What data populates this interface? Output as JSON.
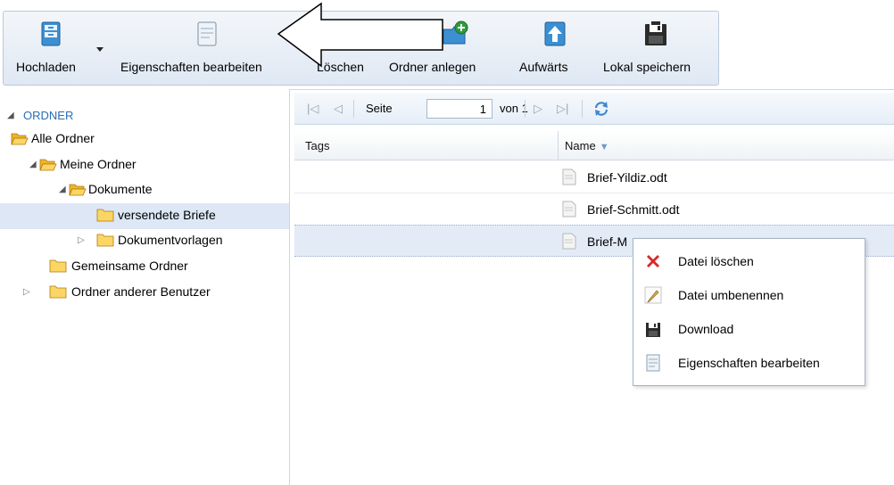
{
  "toolbar": {
    "buttons": [
      {
        "label": "Hochladen",
        "icon": "upload-icon"
      },
      {
        "label": "Eigenschaften bearbeiten",
        "icon": "edit-properties-icon"
      },
      {
        "label": "Löschen",
        "icon": "delete-icon"
      },
      {
        "label": "Ordner anlegen",
        "icon": "new-folder-icon"
      },
      {
        "label": "Aufwärts",
        "icon": "up-arrow-icon"
      },
      {
        "label": "Lokal speichern",
        "icon": "save-local-icon"
      }
    ]
  },
  "tree": {
    "root": "ORDNER",
    "items": [
      {
        "label": "Alle Ordner"
      },
      {
        "label": "Meine Ordner"
      },
      {
        "label": "Dokumente"
      },
      {
        "label": "versendete Briefe"
      },
      {
        "label": "Dokumentvorlagen"
      },
      {
        "label": "Gemeinsame Ordner"
      },
      {
        "label": "Ordner anderer Benutzer"
      }
    ]
  },
  "pager": {
    "page_label": "Seite",
    "page_value": "1",
    "of_label": "von 1"
  },
  "grid": {
    "columns": [
      "Tags",
      "Name"
    ],
    "rows": [
      {
        "tags": "",
        "name": "Brief-Yildiz.odt"
      },
      {
        "tags": "",
        "name": "Brief-Schmitt.odt"
      },
      {
        "tags": "",
        "name": "Brief-M"
      }
    ]
  },
  "context_menu": {
    "items": [
      {
        "label": "Datei löschen",
        "icon": "delete-x-icon"
      },
      {
        "label": "Datei umbenennen",
        "icon": "pencil-icon"
      },
      {
        "label": "Download",
        "icon": "floppy-disk-icon"
      },
      {
        "label": "Eigenschaften bearbeiten",
        "icon": "properties-icon"
      }
    ]
  },
  "colors": {
    "toolbar_bg": "#e6edf6",
    "selection": "#dde7f5",
    "folder": "#f5c842",
    "tree_root": "#2a6db5"
  }
}
